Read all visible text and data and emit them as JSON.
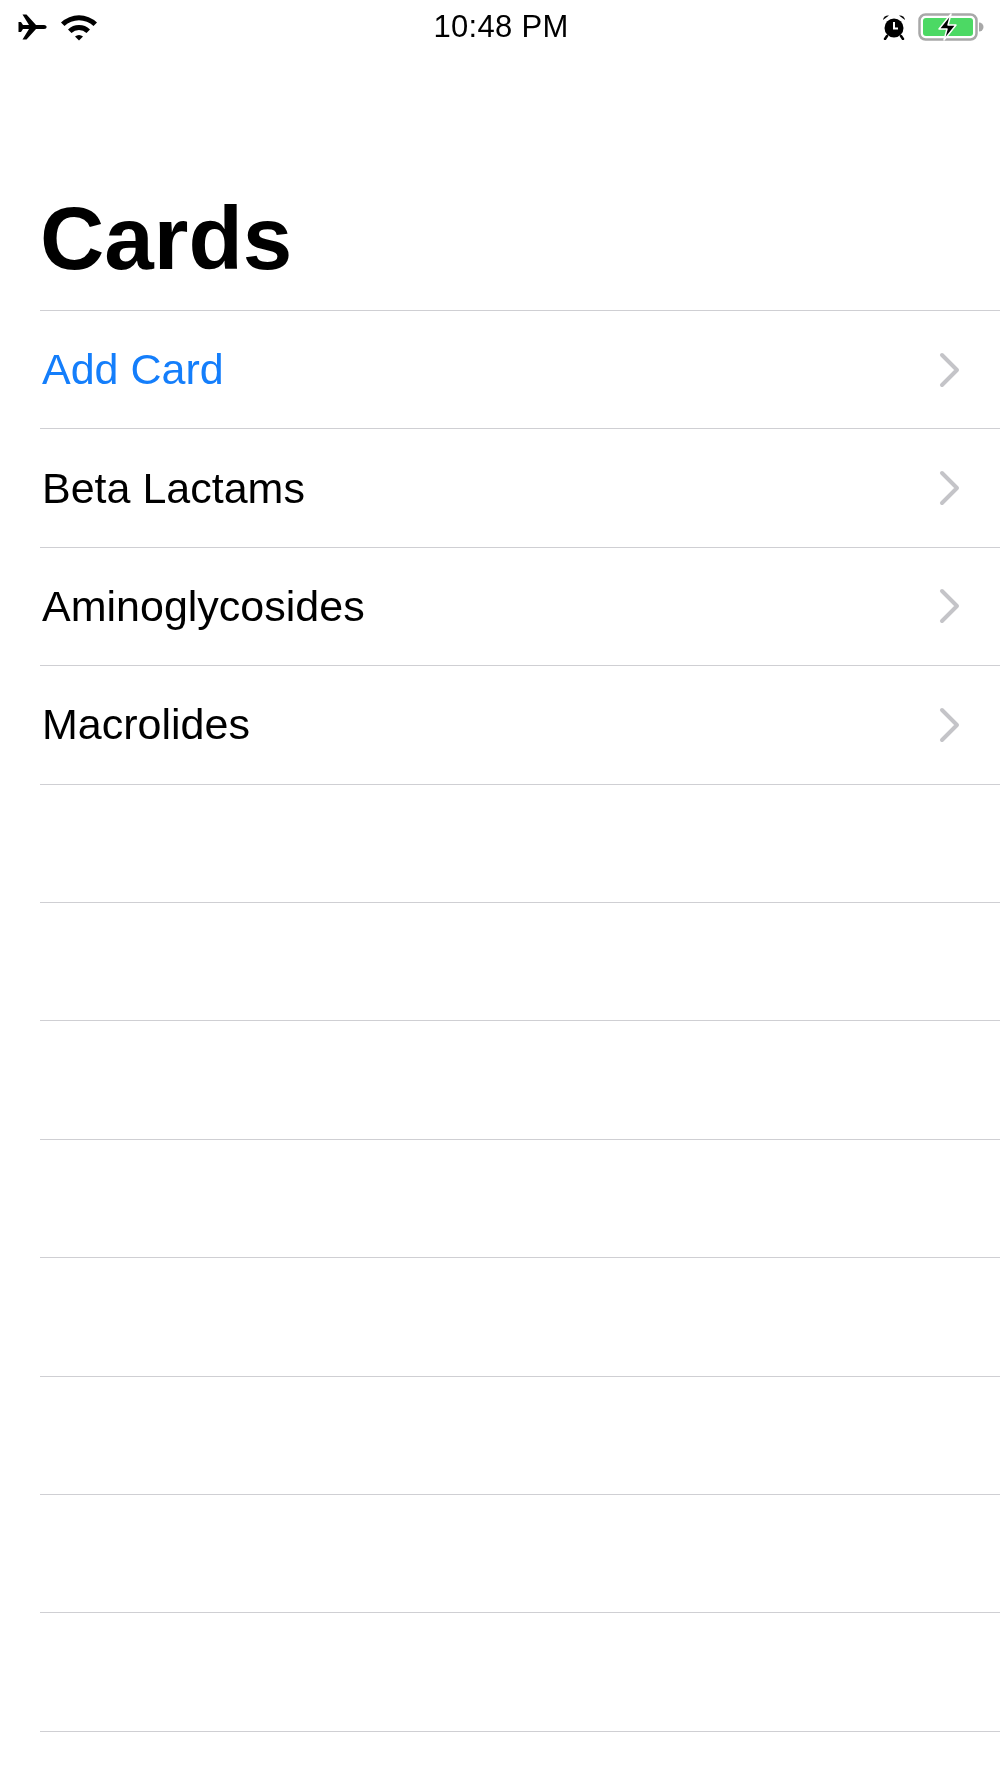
{
  "status_bar": {
    "time": "10:48 PM",
    "airplane_mode": true,
    "wifi": true,
    "alarm": true,
    "charging": true
  },
  "title": "Cards",
  "rows": [
    {
      "label": "Add Card",
      "kind": "action"
    },
    {
      "label": "Beta Lactams",
      "kind": "item"
    },
    {
      "label": "Aminoglycosides",
      "kind": "item"
    },
    {
      "label": "Macrolides",
      "kind": "item"
    }
  ]
}
